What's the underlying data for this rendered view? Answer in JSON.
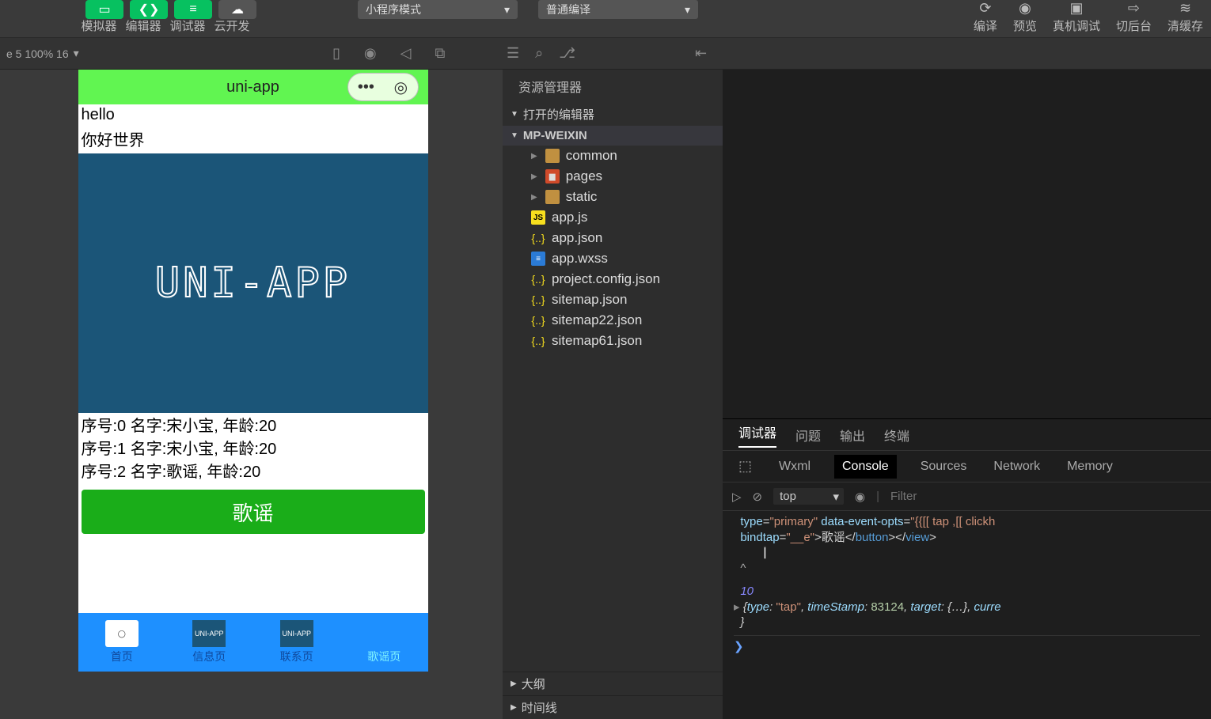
{
  "toolbar": {
    "labels": [
      "模拟器",
      "编辑器",
      "调试器",
      "云开发"
    ],
    "dropdown_left": "小程序模式",
    "dropdown_right": "普通编译",
    "right": [
      "编译",
      "预览",
      "真机调试",
      "切后台",
      "清缓存"
    ]
  },
  "subbar": {
    "info": "e 5 100% 16"
  },
  "phone": {
    "title": "uni-app",
    "text1": "hello",
    "text2": "你好世界",
    "logo": "UNI-APP",
    "rows": [
      "序号:0 名字:宋小宝, 年龄:20",
      "序号:1 名字:宋小宝, 年龄:20",
      "序号:2 名字:歌谣, 年龄:20"
    ],
    "btn": "歌谣",
    "tabs": [
      "首页",
      "信息页",
      "联系页",
      "歌谣页"
    ]
  },
  "explorer": {
    "header": "资源管理器",
    "sections": {
      "open_editors": "打开的编辑器",
      "root": "MP-WEIXIN",
      "outline": "大纲",
      "timeline": "时间线"
    },
    "folders": [
      "common",
      "pages",
      "static"
    ],
    "files": [
      "app.js",
      "app.json",
      "app.wxss",
      "project.config.json",
      "sitemap.json",
      "sitemap22.json",
      "sitemap61.json"
    ]
  },
  "devtools": {
    "tabs1": [
      "调试器",
      "问题",
      "输出",
      "终端"
    ],
    "tabs2": [
      "Wxml",
      "Console",
      "Sources",
      "Network",
      "Memory"
    ],
    "context": "top",
    "filter_placeholder": "Filter",
    "log_count": "10",
    "html_frag_pre": "type=\"primary\" data-event-opts=\"{{[['tap',[['clickh",
    "html_frag": "bindtap=\"__e\">歌谣</button></view>",
    "obj_line": "{type: \"tap\", timeStamp: 83124, target: {…}, curre"
  }
}
